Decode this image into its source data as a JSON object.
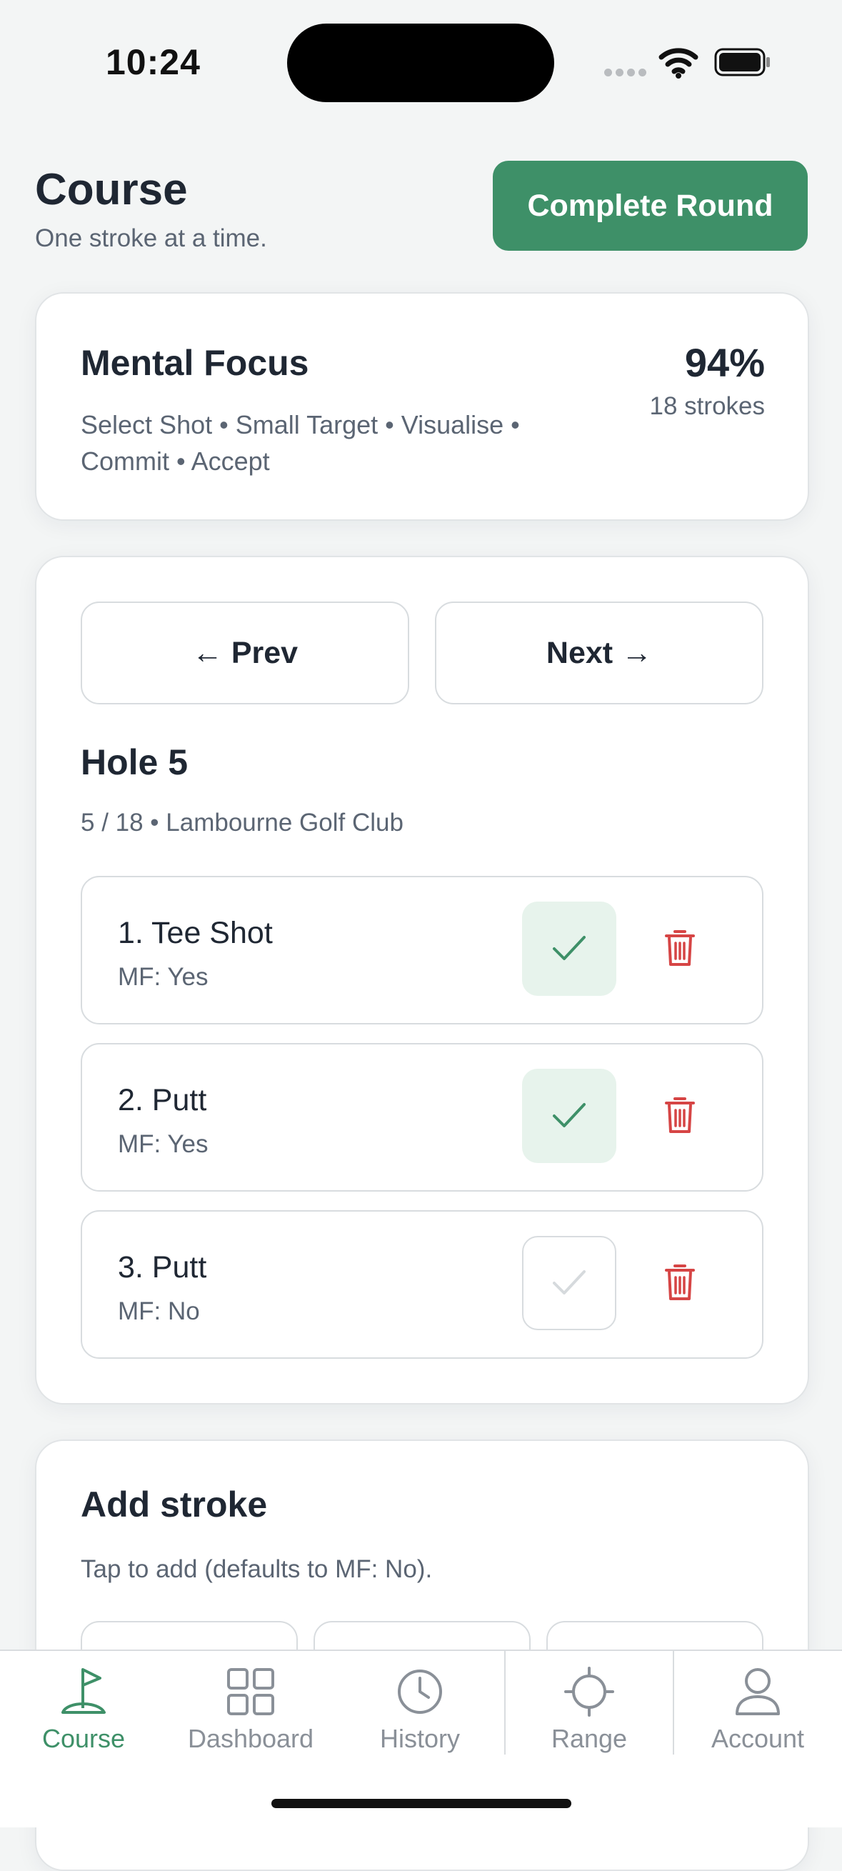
{
  "status": {
    "time": "10:24"
  },
  "header": {
    "title": "Course",
    "subtitle": "One stroke at a time.",
    "complete_label": "Complete Round"
  },
  "mental_focus": {
    "title": "Mental Focus",
    "tags": "Select Shot • Small Target • Visualise • Commit • Accept",
    "percent": "94%",
    "strokes": "18 strokes"
  },
  "hole": {
    "prev_label": "← Prev",
    "next_label": "Next →",
    "title": "Hole 5",
    "meta": "5 / 18 • Lambourne Golf Club",
    "strokes": [
      {
        "name": "1. Tee Shot",
        "mf": "MF: Yes",
        "checked": true
      },
      {
        "name": "2. Putt",
        "mf": "MF: Yes",
        "checked": true
      },
      {
        "name": "3. Putt",
        "mf": "MF: No",
        "checked": false
      }
    ]
  },
  "add_stroke": {
    "title": "Add stroke",
    "hint": "Tap to add (defaults to MF: No)."
  },
  "tabs": [
    {
      "label": "Course",
      "icon": "flag-icon",
      "active": true
    },
    {
      "label": "Dashboard",
      "icon": "grid-icon",
      "active": false
    },
    {
      "label": "History",
      "icon": "clock-icon",
      "active": false
    },
    {
      "label": "Range",
      "icon": "crosshair-icon",
      "active": false
    },
    {
      "label": "Account",
      "icon": "user-icon",
      "active": false
    }
  ],
  "colors": {
    "accent": "#3e9068",
    "danger": "#d64545",
    "check_bg": "#e7f3ec"
  }
}
